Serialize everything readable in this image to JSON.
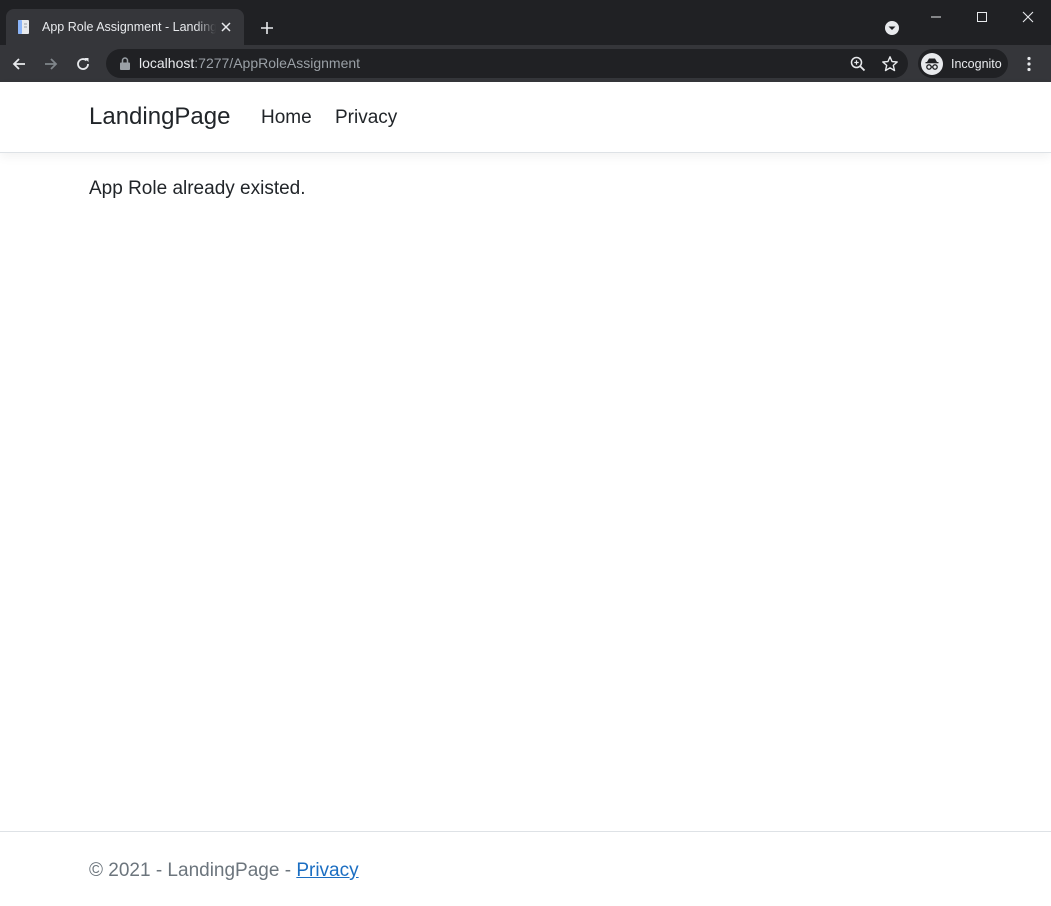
{
  "browser": {
    "tab_title": "App Role Assignment - LandingPage",
    "url_host": "localhost",
    "url_rest": ":7277/AppRoleAssignment",
    "profile_label": "Incognito",
    "theme": {
      "frame": "#202124",
      "toolbar": "#35363a",
      "text": "#e8eaed",
      "muted": "#9aa0a6"
    }
  },
  "site": {
    "brand": "LandingPage",
    "nav": [
      {
        "label": "Home"
      },
      {
        "label": "Privacy"
      }
    ]
  },
  "main": {
    "message": "App Role already existed."
  },
  "footer": {
    "copyright": "© 2021 - LandingPage - ",
    "privacy_link": "Privacy",
    "link_color": "#1b6ec2"
  }
}
